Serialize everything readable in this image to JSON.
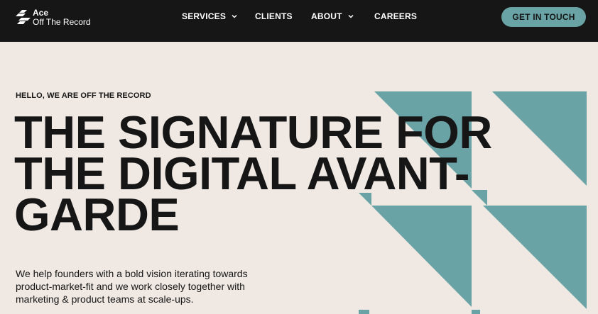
{
  "brand": {
    "line1": "Ace",
    "line2": "Off The Record",
    "mark_icon": "ace-logo-icon"
  },
  "nav": {
    "items": [
      {
        "label": "SERVICES",
        "has_dropdown": true
      },
      {
        "label": "CLIENTS",
        "has_dropdown": false
      },
      {
        "label": "ABOUT",
        "has_dropdown": true
      },
      {
        "label": "CAREERS",
        "has_dropdown": false
      }
    ],
    "cta_label": "GET IN TOUCH"
  },
  "hero": {
    "eyebrow": "HELLO, WE ARE OFF THE RECORD",
    "headline_line1": "THE SIGNATURE FOR",
    "headline_line2": "THE DIGITAL AVANT-",
    "headline_line3": "GARDE",
    "intro_line1": "We help founders with a bold vision iterating towards",
    "intro_line2": "product-market-fit and we work closely together with",
    "intro_line3": "marketing & product teams at scale-ups."
  },
  "colors": {
    "topbar": "#161616",
    "background": "#efe8e3",
    "accent_teal": "#6aa3a5",
    "text": "#161616"
  }
}
